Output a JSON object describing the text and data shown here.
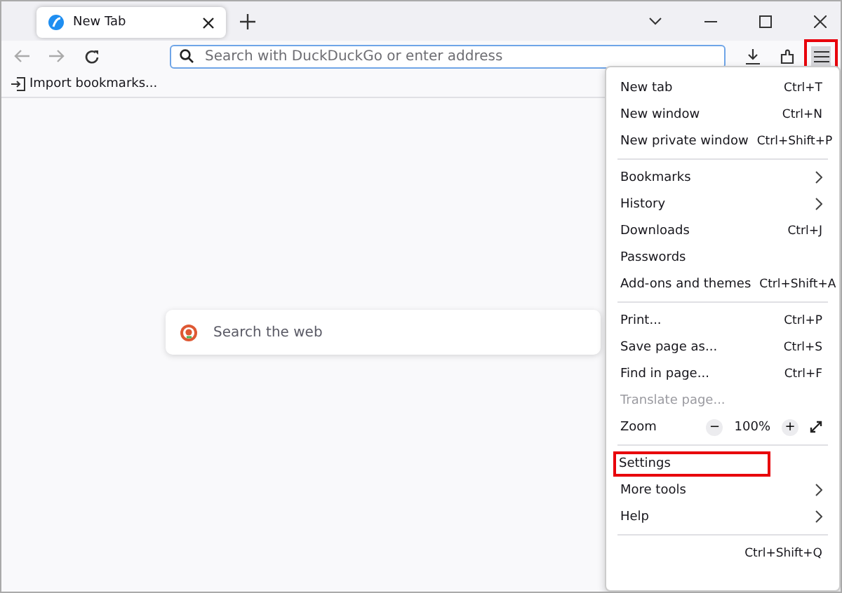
{
  "tab": {
    "title": "New Tab",
    "selected": true
  },
  "address_bar": {
    "placeholder": "Search with DuckDuckGo or enter address"
  },
  "menu_button": {
    "highlighted": true
  },
  "bookmarks_bar": {
    "import_label": "Import bookmarks..."
  },
  "new_tab_search": {
    "placeholder": "Search the web"
  },
  "menu": [
    {
      "kind": "item",
      "label": "New tab",
      "shortcut": "Ctrl+T"
    },
    {
      "kind": "item",
      "label": "New window",
      "shortcut": "Ctrl+N"
    },
    {
      "kind": "item",
      "label": "New private window",
      "shortcut": "Ctrl+Shift+P"
    },
    {
      "kind": "separator"
    },
    {
      "kind": "submenu",
      "label": "Bookmarks"
    },
    {
      "kind": "submenu",
      "label": "History"
    },
    {
      "kind": "item",
      "label": "Downloads",
      "shortcut": "Ctrl+J"
    },
    {
      "kind": "item",
      "label": "Passwords"
    },
    {
      "kind": "item",
      "label": "Add-ons and themes",
      "shortcut": "Ctrl+Shift+A"
    },
    {
      "kind": "separator"
    },
    {
      "kind": "item",
      "label": "Print...",
      "shortcut": "Ctrl+P"
    },
    {
      "kind": "item",
      "label": "Save page as...",
      "shortcut": "Ctrl+S"
    },
    {
      "kind": "item",
      "label": "Find in page...",
      "shortcut": "Ctrl+F"
    },
    {
      "kind": "item",
      "label": "Translate page...",
      "disabled": true
    },
    {
      "kind": "zoom",
      "label": "Zoom",
      "minus": "−",
      "value": "100%",
      "plus": "+"
    },
    {
      "kind": "separator"
    },
    {
      "kind": "item",
      "label": "Settings",
      "highlighted": true
    },
    {
      "kind": "submenu",
      "label": "More tools"
    },
    {
      "kind": "submenu",
      "label": "Help"
    },
    {
      "kind": "separator"
    },
    {
      "kind": "item",
      "shortcut": "Ctrl+Shift+Q"
    }
  ]
}
